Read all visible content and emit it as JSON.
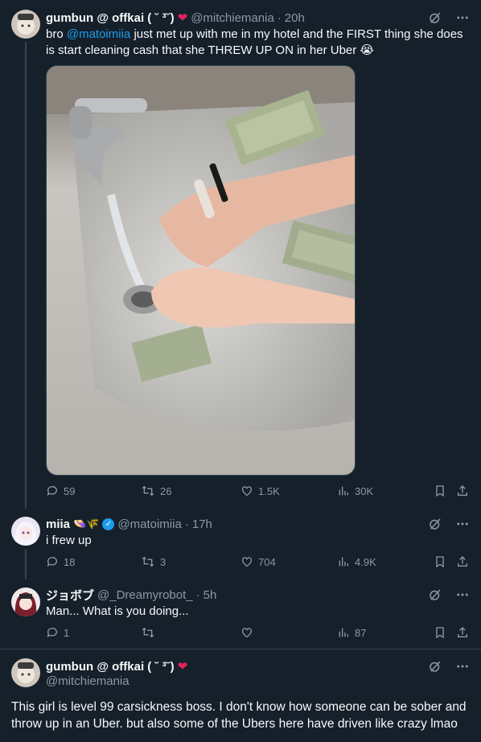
{
  "tweet1": {
    "display_name": "gumbun @ offkai ( ˘ ³˘)",
    "heart": "❤",
    "handle": "@mitchiemania",
    "time": "20h",
    "text_pre": "bro ",
    "mention": "@matoimiia",
    "text_post": " just met up with me in my hotel and the FIRST thing she does is start cleaning cash that she THREW UP ON in her Uber 😭",
    "stats": {
      "replies": "59",
      "retweets": "26",
      "likes": "1.5K",
      "views": "30K"
    }
  },
  "tweet2": {
    "display_name": "miia",
    "emoji": "👒🌾",
    "verified_mark": "✓",
    "handle": "@matoimiia",
    "time": "17h",
    "text": "i frew up",
    "stats": {
      "replies": "18",
      "retweets": "3",
      "likes": "704",
      "views": "4.9K"
    }
  },
  "tweet3": {
    "display_name": "ジョボブ",
    "handle": "@_Dreamyrobot_",
    "time": "5h",
    "text": "Man... What is you doing...",
    "stats": {
      "replies": "1",
      "retweets": "",
      "likes": "",
      "views": "87"
    }
  },
  "tweet4": {
    "display_name": "gumbun @ offkai ( ˘ ³˘)",
    "heart": "❤",
    "handle": "@mitchiemania",
    "text": "This girl is level 99 carsickness boss. I don't know how someone can be sober and throw up in an Uber. but also some of the Ubers here have driven like crazy lmao"
  },
  "separators": {
    "dot": "·"
  },
  "icons": [
    "grok-icon",
    "more-icon",
    "reply-icon",
    "retweet-icon",
    "like-icon",
    "views-icon",
    "bookmark-icon",
    "share-icon"
  ],
  "colors": {
    "background": "#15202b",
    "accent": "#1d9bf0",
    "muted": "#8b98a5",
    "heart": "#e0245e"
  }
}
